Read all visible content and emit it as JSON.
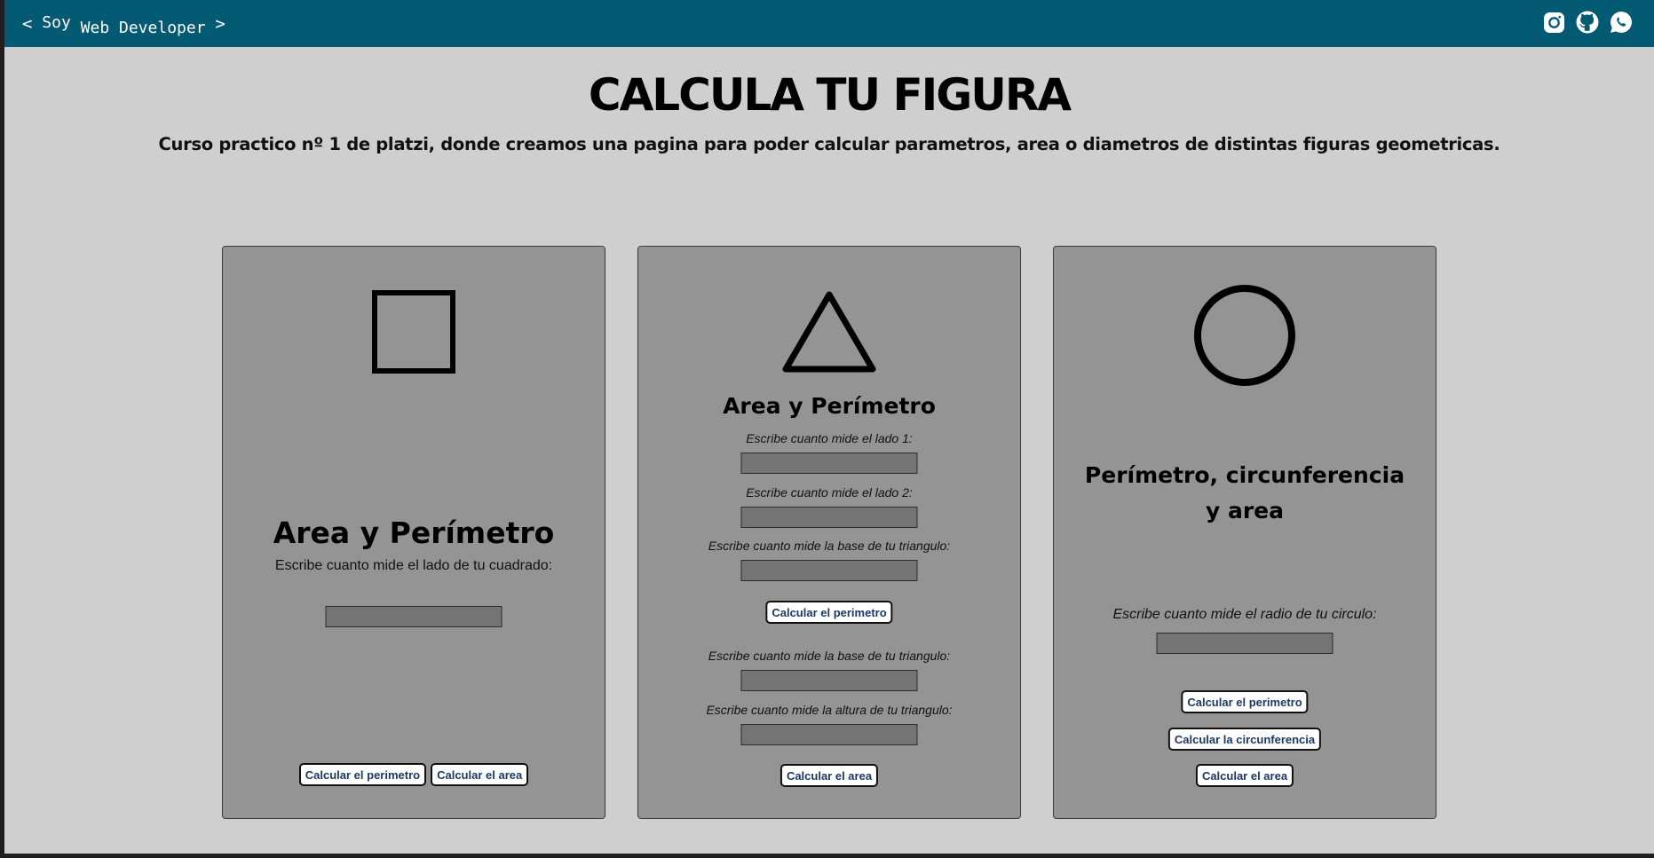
{
  "header": {
    "brand": {
      "lt": "<",
      "soy": "Soy",
      "web": "Web Developer",
      "gt": ">"
    },
    "social": [
      {
        "icon": "instagram-icon"
      },
      {
        "icon": "github-icon"
      },
      {
        "icon": "whatsapp-icon"
      }
    ]
  },
  "main": {
    "title": "CALCULA TU FIGURA",
    "subtitle": "Curso practico nº 1 de platzi, donde creamos una pagina para poder calcular parametros, area o diametros de distintas figuras geometricas."
  },
  "square": {
    "icon": "square-shape-icon",
    "title": "Area y Perímetro",
    "side_label": "Escribe cuanto mide el lado de tu cuadrado:",
    "side_value": "",
    "perimeter_button": "Calcular el perimetro",
    "area_button": "Calcular el area"
  },
  "triangle": {
    "icon": "triangle-shape-icon",
    "title": "Area y Perímetro",
    "side1_label": "Escribe cuanto mide el lado 1:",
    "side2_label": "Escribe cuanto mide el lado 2:",
    "base_label": "Escribe cuanto mide la base de tu triangulo:",
    "perimeter_button": "Calcular el perimetro",
    "base2_label": "Escribe cuanto mide la base de tu triangulo:",
    "height_label": "Escribe cuanto mide la altura de tu triangulo:",
    "area_button": "Calcular el area"
  },
  "circle": {
    "icon": "circle-shape-icon",
    "title_line1": "Perímetro, circunferencia",
    "title_line2": "y area",
    "radius_label": "Escribe cuanto mide el radio de tu circulo:",
    "perimeter_button": "Calcular el perimetro",
    "circumference_button": "Calcular la circunferencia",
    "area_button": "Calcular el area"
  },
  "colors": {
    "header_bg": "#045a72",
    "page_bg": "#cfcfcf",
    "card_bg": "#949494",
    "field_bg": "#747474",
    "button_text": "#1a3a66"
  }
}
